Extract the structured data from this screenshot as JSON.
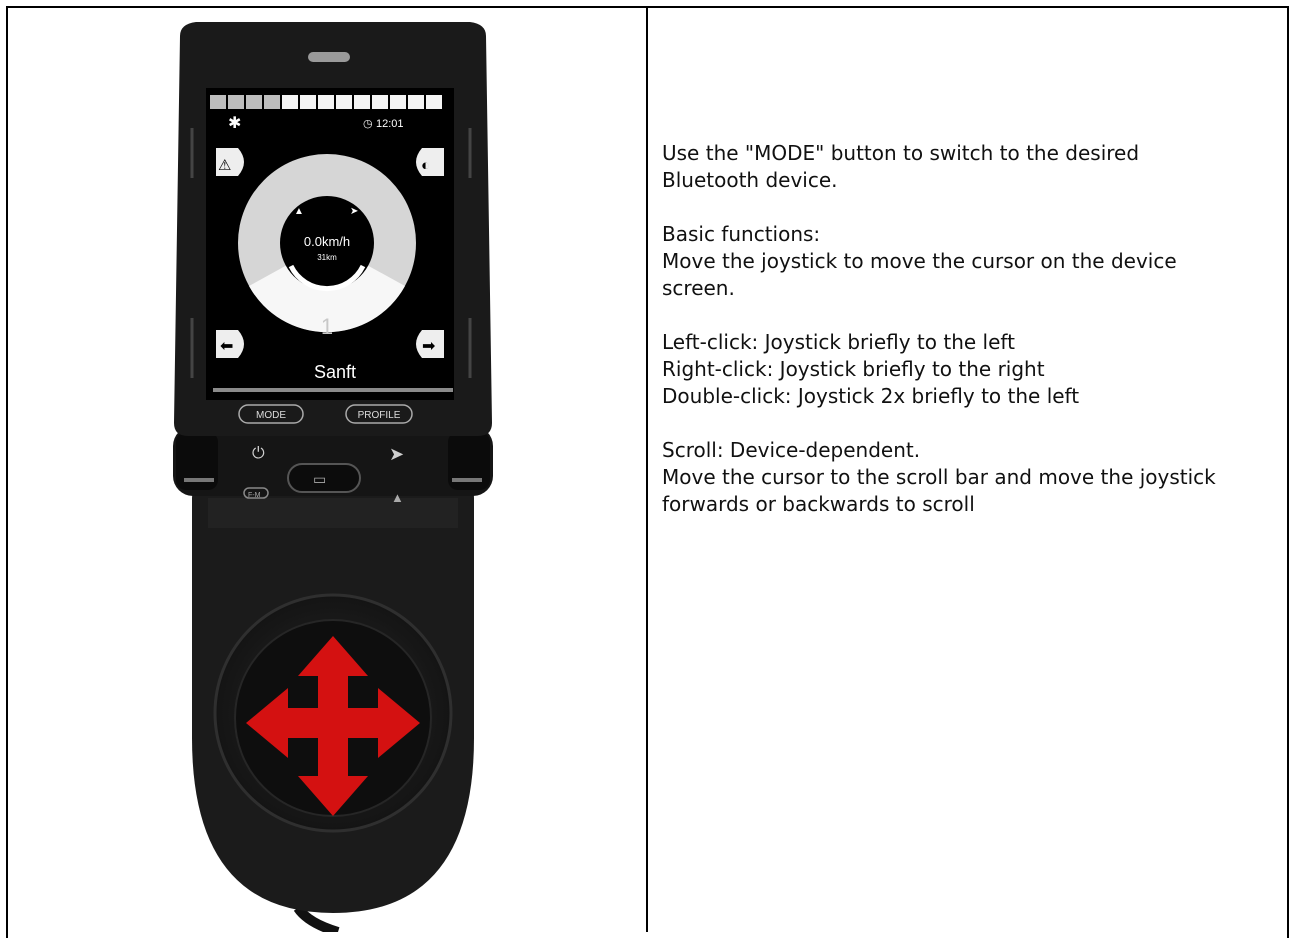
{
  "device": {
    "clock": "12:01",
    "speed": "0.0km/h",
    "distance": "31km",
    "gear": "1",
    "profile_name": "Sanft",
    "mode_button": "MODE",
    "profile_button": "PROFILE",
    "fm_label": "F-M",
    "arrow_color": "#d41111"
  },
  "instructions": {
    "p1": [
      "Use the \"MODE\" button to switch to the desired",
      "Bluetooth device."
    ],
    "p2": [
      "Basic functions:",
      "Move the joystick to move the cursor on the device",
      "screen."
    ],
    "p3": [
      "Left-click: Joystick briefly to the left",
      "Right-click: Joystick briefly to the right",
      "Double-click: Joystick 2x briefly to the left"
    ],
    "p4": [
      "Scroll: Device-dependent.",
      "Move the cursor to the scroll bar and move the joystick",
      "forwards or backwards to scroll"
    ]
  }
}
